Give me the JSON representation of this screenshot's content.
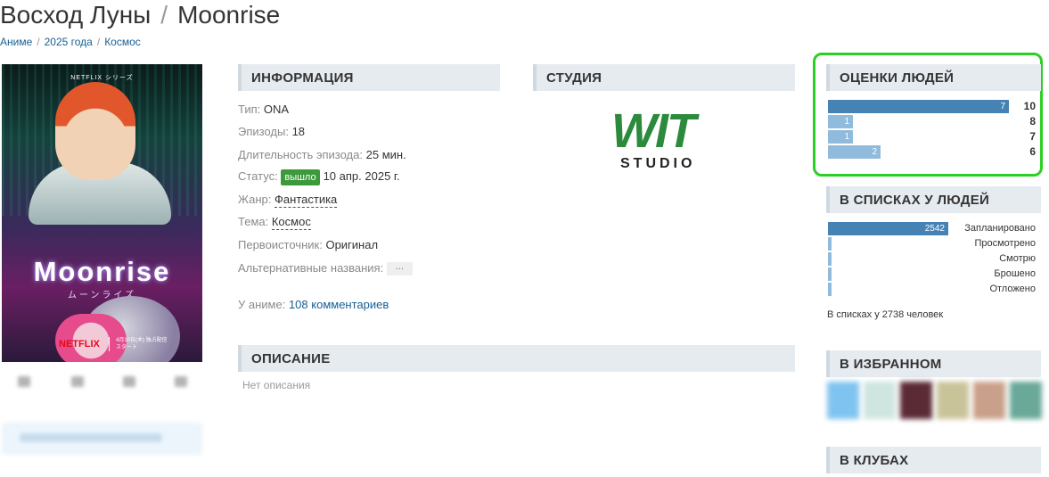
{
  "header": {
    "title_ru": "Восход Луны",
    "title_sep": "/",
    "title_en": "Moonrise"
  },
  "breadcrumb": {
    "items": [
      "Аниме",
      "2025 года",
      "Космос"
    ],
    "sep": "/"
  },
  "poster": {
    "top_text": "NETFLIX シリーズ",
    "logo": "Moonrise",
    "logo_sub": "ムーンライズ",
    "brand": "NETFLIX",
    "date": "4月10日(木) 独占配信スタート"
  },
  "info": {
    "heading": "ИНФОРМАЦИЯ",
    "rows": [
      {
        "label": "Тип:",
        "value": "ONA"
      },
      {
        "label": "Эпизоды:",
        "value": "18"
      },
      {
        "label": "Длительность эпизода:",
        "value": "25 мин."
      },
      {
        "label": "Статус:",
        "badge": "вышло",
        "value": "10 апр. 2025 г."
      },
      {
        "label": "Жанр:",
        "value": "Фантастика"
      },
      {
        "label": "Тема:",
        "value": "Космос"
      },
      {
        "label": "Первоисточник:",
        "value": "Оригинал"
      },
      {
        "label": "Альтернативные названия:",
        "value": "..."
      }
    ],
    "comments_label": "У аниме:",
    "comments_link": "108 комментариев"
  },
  "studio": {
    "heading": "СТУДИЯ",
    "logo_main": "WIT",
    "logo_sub": "STUDIO"
  },
  "description": {
    "heading": "ОПИСАНИЕ",
    "text": "Нет описания"
  },
  "ratings": {
    "heading": "ОЦЕНКИ ЛЮДЕЙ",
    "rows": [
      {
        "score": "10",
        "count": "7",
        "fraction": 1.0,
        "color": "#4682b4"
      },
      {
        "score": "8",
        "count": "1",
        "fraction": 0.14,
        "color": "#90bbdc"
      },
      {
        "score": "7",
        "count": "1",
        "fraction": 0.14,
        "color": "#90bbdc"
      },
      {
        "score": "6",
        "count": "2",
        "fraction": 0.29,
        "color": "#90bbdc"
      }
    ]
  },
  "lists": {
    "heading": "В СПИСКАХ У ЛЮДЕЙ",
    "rows": [
      {
        "label": "Запланировано",
        "count": "2542",
        "fraction": 0.928,
        "color": "#4682b4"
      },
      {
        "label": "Просмотрено",
        "count": "",
        "fraction": 0.004,
        "color": "#90bbdc"
      },
      {
        "label": "Смотрю",
        "count": "",
        "fraction": 0.02,
        "color": "#90bbdc"
      },
      {
        "label": "Брошено",
        "count": "",
        "fraction": 0.01,
        "color": "#90bbdc"
      },
      {
        "label": "Отложено",
        "count": "",
        "fraction": 0.02,
        "color": "#90bbdc"
      }
    ],
    "total": "В списках у 2738 человек"
  },
  "favourites": {
    "heading": "В ИЗБРАННОМ",
    "colors": [
      "#7fc4f0",
      "#cfe6e0",
      "#5a2a35",
      "#c9c39a",
      "#c9a08a",
      "#6aa898"
    ]
  },
  "clubs": {
    "heading": "В КЛУБАХ"
  }
}
